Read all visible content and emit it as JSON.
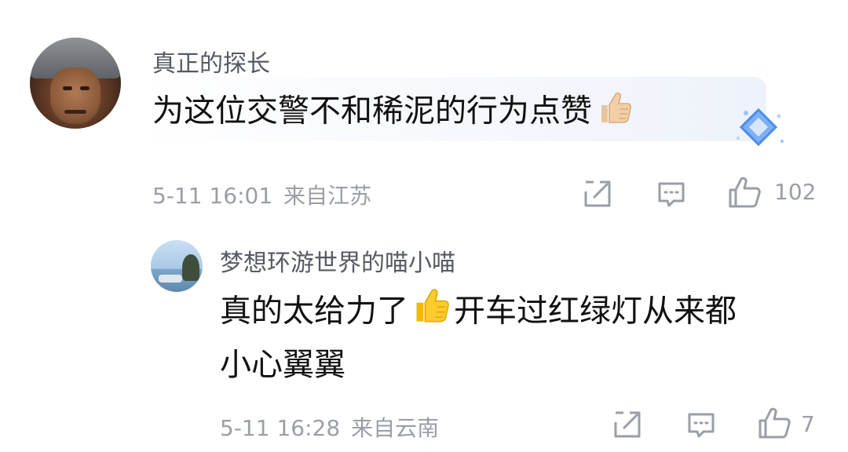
{
  "comments": [
    {
      "username": "真正的探长",
      "text": "为这位交警不和稀泥的行为点赞",
      "emoji": "thumbs-up-icon",
      "time": "5-11 16:01",
      "location": "来自江苏",
      "likes": "102"
    }
  ],
  "reply": {
    "username": "梦想环游世界的喵小喵",
    "text_before_emoji": "真的太给力了",
    "emoji": "thumbs-up-icon",
    "text_after_emoji": "开车过红绿灯从来都",
    "text_line2": "小心翼翼",
    "time": "5-11 16:28",
    "location": "来自云南",
    "likes": "7"
  },
  "colors": {
    "meta_gray": "#9a9ea6",
    "name_gray": "#555a62",
    "badge_blue": "#4a8df0"
  }
}
